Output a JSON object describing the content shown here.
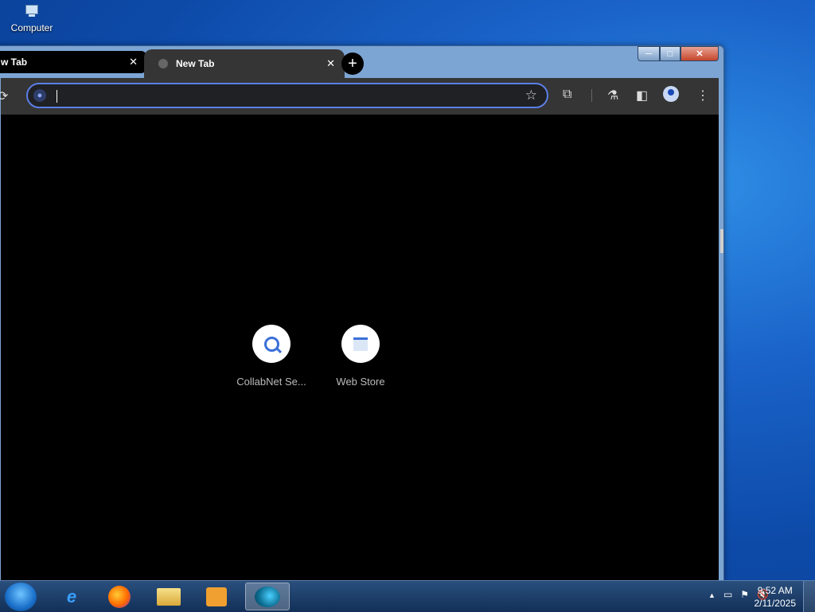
{
  "desktop": {
    "icon_label": "Computer"
  },
  "window": {
    "min": "─",
    "max": "□",
    "close": "✕"
  },
  "tabs": [
    {
      "label": "w Tab",
      "close": "✕"
    },
    {
      "label": "New Tab",
      "close": "✕"
    }
  ],
  "new_tab_symbol": "+",
  "toolbar": {
    "reload": "⟳",
    "omnibox_value": "",
    "star": "☆",
    "extensions": "⧉",
    "labs": "⚗",
    "sidepanel": "◧",
    "menu": "⋮"
  },
  "shortcuts": [
    {
      "label": "CollabNet Se...",
      "icon": "search-icon"
    },
    {
      "label": "Web Store",
      "icon": "webstore-icon"
    }
  ],
  "taskbar": {
    "apps": [
      "internet-explorer",
      "firefox",
      "file-explorer",
      "media-player",
      "chrome"
    ],
    "tray_arrow": "▲",
    "time": "9:52 AM",
    "date": "2/11/2025"
  }
}
